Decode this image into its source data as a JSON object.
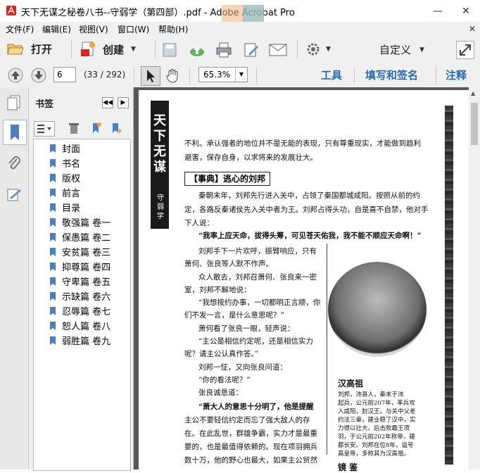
{
  "window": {
    "title": "天下无谋之秘卷八书--守弱学（第四部）.pdf - Adobe Acrobat Pro",
    "minimize_glyph": "—",
    "close_glyph": "✕"
  },
  "menu": {
    "items": [
      "文件(F)",
      "编辑(E)",
      "视图(V)",
      "窗口(W)",
      "帮助(H)"
    ],
    "close_doc_glyph": "✕"
  },
  "toolbar": {
    "open_label": "打开",
    "create_label": "创建",
    "customize_label": "自定义",
    "tools_label": "工具",
    "fill_sign_label": "填写和签名",
    "comment_label": "注释",
    "page_number": "6",
    "page_count": "(33 / 292)",
    "zoom": "65.3%"
  },
  "panel": {
    "title": "书签",
    "bookmarks": [
      "封面",
      "书名",
      "版权",
      "前言",
      "目录",
      "敬强篇 卷一",
      "保愚篇 卷二",
      "安贫篇 卷三",
      "抑尊篇 卷四",
      "守卑篇 卷五",
      "示缺篇 卷六",
      "忍辱篇 卷七",
      "恕人篇 卷八",
      "弱胜篇 卷九"
    ]
  },
  "document": {
    "spine_title": "天下无谋",
    "spine_sub": "守弱学",
    "intro_lines": [
      "不利。承认强者的地位并不是无能的表现，只有尊重现实，才能做到趋利",
      "避害，保存自身，以求将来的发展壮大。"
    ],
    "section_heading": "【事典】逃心的刘邦",
    "body_lines": [
      "秦朝末年，刘邦先行进入关中，占领了秦国都城咸阳。按照从前的约",
      "定，各路反秦诸侯先入关中者为王。刘邦占得头功，自是喜不自禁，他对手",
      "下人说：",
      "“我率上应天命，拔得头筹，可见苍天佑我，我不能不顺应天命啊！”",
      "刘邦手下一片欢呼，振臂响应，只有",
      "萧何、张良等人默不作声。",
      "众人散去，刘邦召萧何、张良来一密",
      "室，刘邦不解地说：",
      "“我想按约办事，一切都明正言顺，你",
      "们不发一言，是什么意思呢？”",
      "萧何看了张良一眼，轻声说：",
      "“主公是相信约定呢，还是相信实力",
      "呢？请主公认真作答。”",
      "刘邦一怔，又向张良问道：",
      "“你的看法呢？”",
      "张良诚恳道：",
      "“萧大人的意思十分明了，他是提醒",
      "主公不要轻信约定而忘了强大敌人的存",
      "在。在此乱世，群雄争霸，实力才是最重",
      "要的，也是最值得依赖的。现在项羽拥兵",
      "数十万，他的野心也最大，如果主公贸然"
    ],
    "caption_title": "汉高祖",
    "caption_lines": [
      "刘邦，沛县人，秦末于沛",
      "起兵，公元前207年，率兵攻",
      "入咸阳，封汉王。与关中父老",
      "约法三章，建业稳了汉中，实",
      "力得以壮大。后击败霸王项",
      "羽，于公元前202年称帝，建",
      "都长安。刘邦在位8年，谥号",
      "高皇帝，多称其为汉高祖。"
    ],
    "footer_partial": "镜 鉴"
  }
}
